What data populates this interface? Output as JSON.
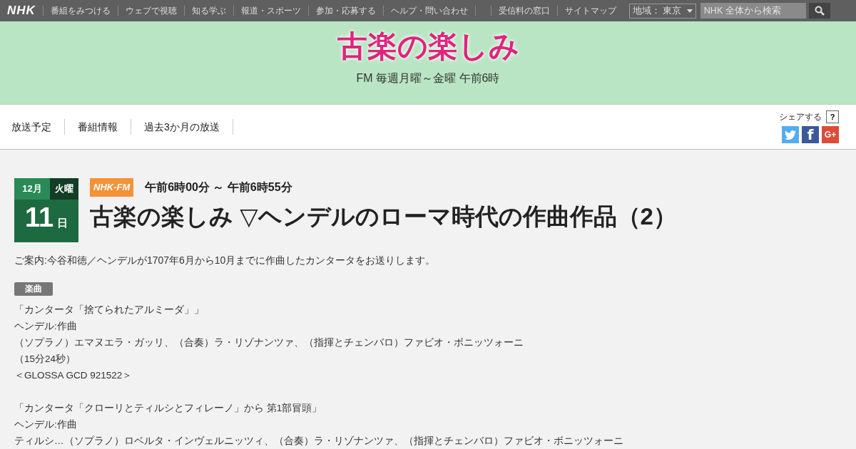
{
  "global_nav": {
    "logo": "NHK",
    "items": [
      "番組をみつける",
      "ウェブで視聴",
      "知る学ぶ",
      "報道・スポーツ",
      "参加・応募する",
      "ヘルプ・問い合わせ"
    ],
    "links": [
      "受信料の窓口",
      "サイトマップ"
    ],
    "region": "地域： 東京",
    "search": {
      "placeholder": "NHK 全体から検索"
    }
  },
  "banner": {
    "title": "古楽の楽しみ",
    "subtitle": "FM 毎週月曜～金曜 午前6時"
  },
  "program_nav": {
    "tabs": [
      "放送予定",
      "番組情報",
      "過去3か月の放送"
    ],
    "share_label": "シェアする",
    "help": "?",
    "share_buttons": [
      {
        "kind": "twitter",
        "color": "#55acee"
      },
      {
        "kind": "facebook",
        "label": "f",
        "color": "#3b5998"
      },
      {
        "kind": "gplus",
        "label": "G+",
        "color": "#dd4b39"
      }
    ]
  },
  "episode": {
    "month": "12月",
    "weekday": "火曜",
    "day": "11",
    "day_unit": "日",
    "channel": "NHK-FM",
    "time": "午前6時00分 ～ 午前6時55分",
    "title": "古楽の楽しみ ▽ヘンデルのローマ時代の作曲作品（2）",
    "description": "ご案内:今谷和徳／ヘンデルが1707年6月から10月までに作曲したカンタータをお送りします。",
    "tag": "楽曲",
    "tracks": [
      {
        "lines": [
          "「カンタータ「捨てられたアルミーダ」」",
          "ヘンデル:作曲",
          "（ソプラノ）エマヌエラ・ガッリ、（合奏）ラ・リゾナンツァ、（指揮とチェンバロ）ファビオ・ボニッツォーニ",
          "（15分24秒）",
          "＜GLOSSA GCD 921522＞"
        ]
      },
      {
        "lines": [
          "「カンタータ「クローリとティルシとフィレーノ」から 第1部冒頭」",
          "ヘンデル:作曲",
          "ティルシ…（ソプラノ）ロベルタ・インヴェルニッツィ、（合奏）ラ・リゾナンツァ、（指揮とチェンバロ）ファビオ・ボニッツォーニ"
        ]
      }
    ]
  }
}
